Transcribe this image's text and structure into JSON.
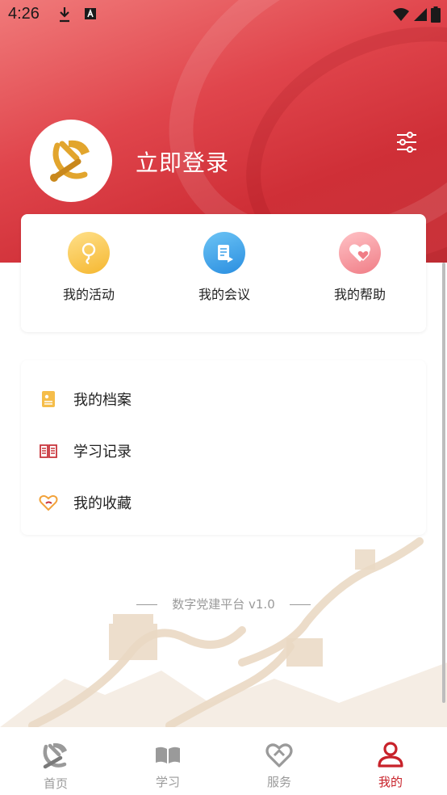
{
  "status_bar": {
    "time": "4:26",
    "icons": [
      "download-icon",
      "accessibility-icon",
      "wifi-icon",
      "signal-icon",
      "battery-icon"
    ]
  },
  "profile": {
    "login_label": "立即登录",
    "avatar_icon": "party-emblem-icon",
    "settings_icon": "filter-sliders-icon"
  },
  "quick_actions": [
    {
      "label": "我的活动",
      "icon": "activity-bulb-icon",
      "color": "#f5c242"
    },
    {
      "label": "我的会议",
      "icon": "meeting-doc-icon",
      "color": "#3aa0ea"
    },
    {
      "label": "我的帮助",
      "icon": "help-heart-icon",
      "color": "#f07d86"
    }
  ],
  "menu": [
    {
      "label": "我的档案",
      "icon": "profile-file-icon",
      "color": "#f2b23a"
    },
    {
      "label": "学习记录",
      "icon": "book-record-icon",
      "color": "#c8333a"
    },
    {
      "label": "我的收藏",
      "icon": "favorite-heart-icon",
      "color": "#f2a23a"
    }
  ],
  "footer": {
    "version": "数字党建平台 v1.0"
  },
  "tabbar": {
    "tabs": [
      {
        "label": "首页",
        "icon": "party-emblem-icon",
        "active": false
      },
      {
        "label": "学习",
        "icon": "book-icon",
        "active": false
      },
      {
        "label": "服务",
        "icon": "heart-hand-icon",
        "active": false
      },
      {
        "label": "我的",
        "icon": "user-icon",
        "active": true
      }
    ],
    "active_color": "#c8222a",
    "inactive_color": "#9a9a9a"
  }
}
